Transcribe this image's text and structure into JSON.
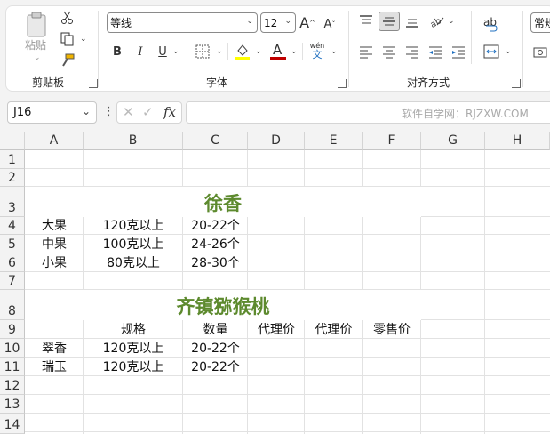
{
  "ribbon": {
    "clipboard": {
      "paste_label": "粘贴",
      "group_label": "剪贴板"
    },
    "font": {
      "name": "等线",
      "size": "12",
      "grow_label": "A",
      "shrink_label": "A",
      "bold": "B",
      "italic": "I",
      "underline": "U",
      "font_color_letter": "A",
      "phonetic_top": "wén",
      "phonetic_bottom": "文",
      "group_label": "字体",
      "fill_color": "#ffff00",
      "font_color": "#c00000"
    },
    "alignment": {
      "group_label": "对齐方式",
      "wrap_label": "ab"
    },
    "number": {
      "format": "常规"
    }
  },
  "formula_bar": {
    "name_box": "J16",
    "fx": "fx",
    "watermark": "软件自学网：RJZXW.COM"
  },
  "columns": [
    "A",
    "B",
    "C",
    "D",
    "E",
    "F",
    "G",
    "H"
  ],
  "rows": [
    "1",
    "2",
    "3",
    "4",
    "5",
    "6",
    "7",
    "8",
    "9",
    "10",
    "11",
    "12",
    "13",
    "14"
  ],
  "sheet": {
    "title1": "徐香",
    "r4": [
      "大果",
      "120克以上",
      "20-22个"
    ],
    "r5": [
      "中果",
      "100克以上",
      "24-26个"
    ],
    "r6": [
      "小果",
      "80克以上",
      "28-30个"
    ],
    "title2": "齐镇猕猴桃",
    "r9": [
      "规格",
      "数量",
      "代理价",
      "代理价",
      "零售价"
    ],
    "r10": [
      "翠香",
      "120克以上",
      "20-22个"
    ],
    "r11": [
      "瑞玉",
      "120克以上",
      "20-22个"
    ]
  }
}
